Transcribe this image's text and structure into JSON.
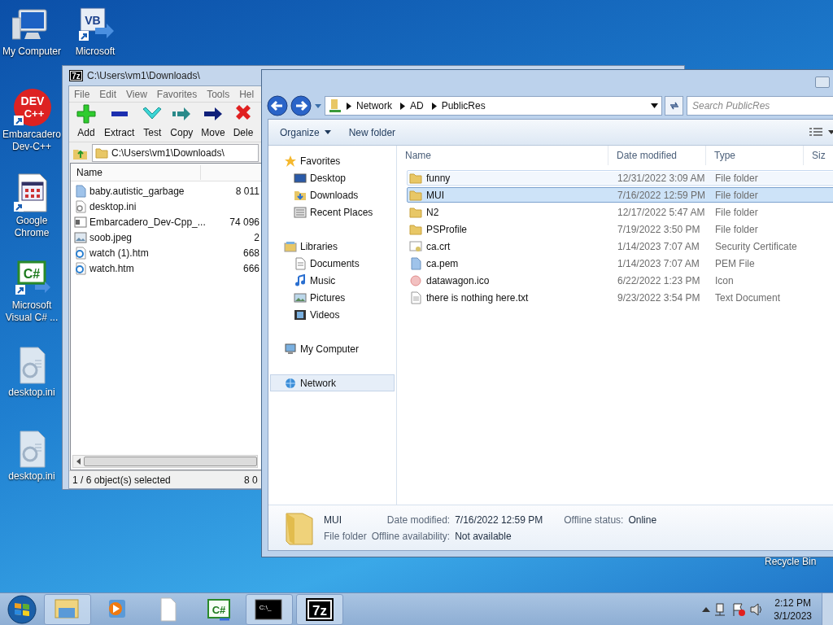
{
  "desktop_icons": [
    {
      "label": "My Computer",
      "kind": "computer"
    },
    {
      "label": "Microsoft",
      "kind": "vb",
      "icon_text": [
        "VB"
      ]
    },
    {
      "label": "Embarcadero Dev-C++",
      "kind": "devcpp",
      "icon_text": [
        "DEV",
        "C++"
      ]
    },
    {
      "label": "Google Chrome",
      "kind": "app"
    },
    {
      "label": "Microsoft Visual C# ...",
      "kind": "csharp",
      "icon_text": [
        "C#"
      ]
    },
    {
      "label": "desktop.ini",
      "kind": "ini"
    },
    {
      "label": "desktop.ini",
      "kind": "ini"
    },
    {
      "label": "Recycle Bin",
      "kind": "label"
    }
  ],
  "archive_window": {
    "title": "C:\\Users\\vm1\\Downloads\\",
    "logo_text": "7z",
    "menu": [
      "File",
      "Edit",
      "View",
      "Favorites",
      "Tools",
      "Hel"
    ],
    "toolbar": [
      {
        "label": "Add",
        "kind": "add"
      },
      {
        "label": "Extract",
        "kind": "extract"
      },
      {
        "label": "Test",
        "kind": "test"
      },
      {
        "label": "Copy",
        "kind": "copy"
      },
      {
        "label": "Move",
        "kind": "move"
      },
      {
        "label": "Dele",
        "kind": "delete"
      }
    ],
    "path": "C:\\Users\\vm1\\Downloads\\",
    "columns": [
      "Name"
    ],
    "rows": [
      {
        "name": "baby.autistic_garbage",
        "size": "8 011",
        "kind": "file"
      },
      {
        "name": "desktop.ini",
        "kind": "ini"
      },
      {
        "name": "Embarcadero_Dev-Cpp_...",
        "size": "74 096",
        "kind": "exe"
      },
      {
        "name": "soob.jpeg",
        "size": "2",
        "kind": "image"
      },
      {
        "name": "watch (1).htm",
        "size": "668",
        "kind": "htm"
      },
      {
        "name": "watch.htm",
        "size": "666",
        "kind": "htm"
      }
    ],
    "status": "1 / 6 object(s) selected",
    "status_size": "8 0"
  },
  "explorer_window": {
    "breadcrumb": [
      "Network",
      "AD",
      "PublicRes"
    ],
    "search": {
      "placeholder": "Search PublicRes"
    },
    "commands": [
      {
        "label": "Organize",
        "dropdown": true
      },
      {
        "label": "New folder",
        "dropdown": false
      }
    ],
    "nav": [
      {
        "label": "Favorites",
        "kind": "star",
        "selected": false,
        "children": [
          {
            "label": "Desktop",
            "kind": "desktop",
            "selected": false
          },
          {
            "label": "Downloads",
            "kind": "downloads",
            "selected": false
          },
          {
            "label": "Recent Places",
            "kind": "recent",
            "selected": false
          }
        ]
      },
      {
        "label": "Libraries",
        "kind": "library",
        "selected": false,
        "children": [
          {
            "label": "Documents",
            "kind": "documents",
            "selected": false
          },
          {
            "label": "Music",
            "kind": "music",
            "selected": false
          },
          {
            "label": "Pictures",
            "kind": "pictures",
            "selected": false
          },
          {
            "label": "Videos",
            "kind": "videos",
            "selected": false
          }
        ]
      },
      {
        "label": "My Computer",
        "kind": "computer",
        "selected": false
      },
      {
        "label": "Network",
        "kind": "network",
        "selected": true
      }
    ],
    "columns": [
      "Name",
      "Date modified",
      "Type",
      "Siz"
    ],
    "rows": [
      {
        "name": "funny",
        "date": "12/31/2022 3:09 AM",
        "type": "File folder",
        "kind": "folder",
        "selected": false,
        "hovered": true
      },
      {
        "name": "MUI",
        "date": "7/16/2022 12:59 PM",
        "type": "File folder",
        "kind": "folder",
        "selected": true,
        "hovered": false
      },
      {
        "name": "N2",
        "date": "12/17/2022 5:47 AM",
        "type": "File folder",
        "kind": "folder",
        "selected": false,
        "hovered": false
      },
      {
        "name": "PSProfile",
        "date": "7/19/2022 3:50 PM",
        "type": "File folder",
        "kind": "folder",
        "selected": false,
        "hovered": false
      },
      {
        "name": "ca.crt",
        "date": "1/14/2023 7:07 AM",
        "type": "Security Certificate",
        "kind": "cert",
        "selected": false,
        "hovered": false
      },
      {
        "name": "ca.pem",
        "date": "1/14/2023 7:07 AM",
        "type": "PEM File",
        "kind": "file",
        "selected": false,
        "hovered": false
      },
      {
        "name": "datawagon.ico",
        "date": "6/22/2022 1:23 PM",
        "type": "Icon",
        "kind": "ico",
        "selected": false,
        "hovered": false
      },
      {
        "name": "there is nothing here.txt",
        "date": "9/23/2022 3:54 PM",
        "type": "Text Document",
        "kind": "text",
        "selected": false,
        "hovered": false
      }
    ],
    "details": {
      "name": "MUI",
      "type": "File folder",
      "fields": [
        {
          "label": "Date modified:",
          "value": "7/16/2022 12:59 PM"
        },
        {
          "label": "Offline status:",
          "value": "Online"
        },
        {
          "label": "Offline availability:",
          "value": "Not available"
        }
      ]
    }
  },
  "taskbar": {
    "items": [
      {
        "kind": "explorer",
        "open": true
      },
      {
        "kind": "media",
        "open": false
      },
      {
        "kind": "blank",
        "open": false
      },
      {
        "kind": "csharp",
        "open": false,
        "icon_text": "C#"
      },
      {
        "kind": "console",
        "open": true,
        "icon_text": "C:\\_"
      },
      {
        "kind": "archiver",
        "open": true,
        "icon_text": "7z"
      }
    ],
    "time": "2:12 PM",
    "date": "3/1/2023"
  }
}
